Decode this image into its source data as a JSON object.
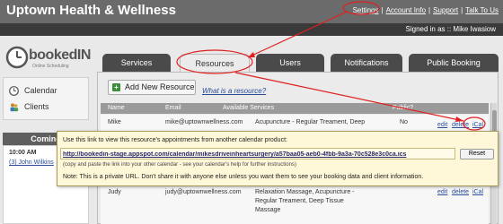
{
  "header": {
    "title": "Uptown Health & Wellness",
    "links": [
      "Settings",
      "Account Info",
      "Support",
      "Talk To Us"
    ],
    "signed_in": "Signed in as :: Mike Iwasiow"
  },
  "logo": {
    "text": "bookedIN",
    "subtitle": "Online Scheduling"
  },
  "tabs": [
    "Services",
    "Resources",
    "Users",
    "Notifications",
    "Public Booking"
  ],
  "sidebar": {
    "items": [
      {
        "label": "Calendar",
        "icon": "clock-icon"
      },
      {
        "label": "Clients",
        "icon": "people-icon"
      }
    ],
    "coming_title": "Coming",
    "coming_time": "10:00 AM",
    "coming_appt": "(3) John Wilkins"
  },
  "main": {
    "add_button": "Add New Resource",
    "what_link": "What is a resource?",
    "columns": [
      "Name",
      "Email",
      "Available Services",
      "Public?"
    ],
    "rows": [
      {
        "name": "Mike",
        "email": "mike@uptownwellness.com",
        "services": "Acupuncture - Regular Treament, Deep",
        "public": "No",
        "actions": [
          "edit",
          "delete",
          "iCal"
        ]
      },
      {
        "name": "Judy",
        "email": "judy@uptownwellness.com",
        "services": "Relaxation Massage, Acupuncture - Regular Treament, Deep Tissue Massage",
        "public": "",
        "actions": [
          "edit",
          "delete",
          "iCal"
        ]
      }
    ],
    "judy_services_lines": [
      "Relaxation Massage, Acupuncture -",
      "Regular Treament, Deep Tissue",
      "Massage"
    ]
  },
  "popup": {
    "line1": "Use this link to view this resource's appointments from another calendar product:",
    "url": "http://bookedin-stage.appspot.com/calendar/mikesdriveinheartsurgery/a57baa05-aeb0-4fbb-9a3a-70c528e3c0ca.ics",
    "reset": "Reset",
    "hint": "(copy and paste the link into your other calendar - see your calendar's help for further instructions)",
    "note": "Note: This is a private URL. Don't share it with anyone else unless you want them to see your booking data and client information."
  },
  "colors": {
    "annotation": "#e02020",
    "link": "#2a4d9a",
    "popup_bg": "#fff8d8"
  }
}
